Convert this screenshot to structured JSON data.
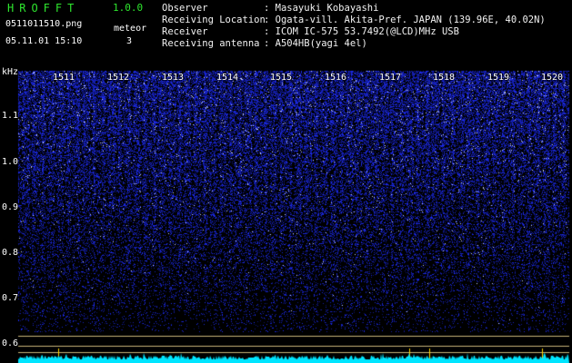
{
  "app": {
    "title": "HROFFT",
    "version": "1.0.0",
    "filename": "0511011510.png",
    "timestamp": "05.11.01 15:10",
    "count_label": "meteor",
    "count_value": "3"
  },
  "info": [
    {
      "label": "Observer",
      "value": ": Masayuki Kobayashi"
    },
    {
      "label": "Receiving Location",
      "value": ": Ogata-vill. Akita-Pref. JAPAN (139.96E, 40.02N)"
    },
    {
      "label": "Receiver",
      "value": ": ICOM IC-575 53.7492(@LCD)MHz USB"
    },
    {
      "label": "Receiving antenna",
      "value": ": A504HB(yagi 4el)"
    }
  ],
  "axis": {
    "y_unit": "kHz",
    "y_ticks": [
      "1.1",
      "1.0",
      "0.9",
      "0.8",
      "0.7",
      "0.6"
    ],
    "x_ticks": [
      "1511",
      "1512",
      "1513",
      "1514",
      "1515",
      "1516",
      "1517",
      "1518",
      "1519",
      "1520"
    ]
  },
  "colors": {
    "background": "#000000",
    "title": "#2ee62e",
    "noise": "#1e2dff",
    "spectrum": "#00e5ff",
    "marker": "#ffd400",
    "baseline": "#c8b478"
  }
}
